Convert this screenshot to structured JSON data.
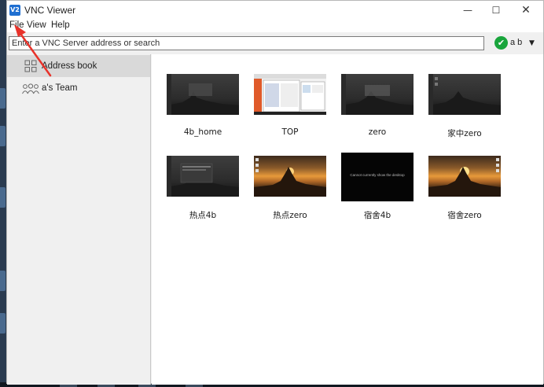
{
  "window": {
    "title": "VNC Viewer",
    "app_icon_text": "V2",
    "minimize": "—",
    "maximize": "☐",
    "close": "✕"
  },
  "menu": {
    "file": "File",
    "view": "View",
    "help": "Help"
  },
  "search": {
    "placeholder": "Enter a VNC Server address or search"
  },
  "account": {
    "name": "a b",
    "check": "✔",
    "dropdown": "▼"
  },
  "sidebar": {
    "items": [
      {
        "label": "Address book",
        "active": true
      },
      {
        "label": "a's Team",
        "active": false
      }
    ]
  },
  "connections": [
    {
      "label": "4b_home"
    },
    {
      "label": "TOP"
    },
    {
      "label": "zero"
    },
    {
      "label": "家中zero"
    },
    {
      "label": "热点4b"
    },
    {
      "label": "热点zero"
    },
    {
      "label": "宿舍4b",
      "message": "Cannot currently show the desktop"
    },
    {
      "label": "宿舍zero"
    }
  ],
  "colors": {
    "accent": "#1f6fd1",
    "check": "#19a53c",
    "arrow": "#e8322a"
  }
}
